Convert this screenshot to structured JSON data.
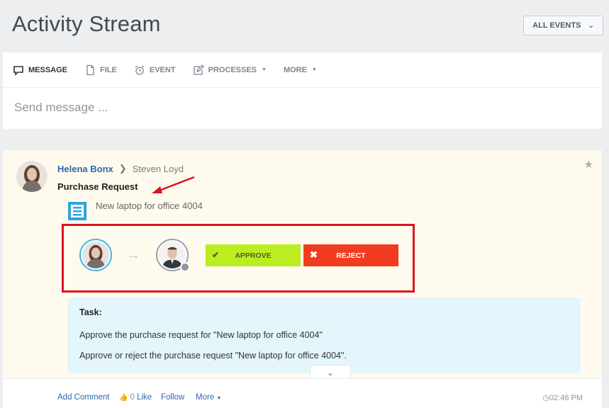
{
  "header": {
    "title": "Activity Stream",
    "filter_label": "ALL EVENTS"
  },
  "composer": {
    "tabs": [
      {
        "label": "MESSAGE",
        "icon": "speech-bubble-icon"
      },
      {
        "label": "FILE",
        "icon": "file-icon"
      },
      {
        "label": "EVENT",
        "icon": "alarm-clock-icon"
      },
      {
        "label": "PROCESSES",
        "icon": "edit-icon"
      },
      {
        "label": "MORE"
      }
    ],
    "placeholder": "Send message ..."
  },
  "post": {
    "author": "Helena Bonx",
    "recipient": "Steven Loyd",
    "title": "Purchase Request",
    "document_title": "New laptop for office 4004",
    "approve_label": "APPROVE",
    "reject_label": "REJECT",
    "task": {
      "heading": "Task:",
      "line1": "Approve the purchase request for \"New laptop for office 4004\"",
      "line2": "Approve or reject the purchase request \"New laptop for office 4004\"."
    },
    "footer": {
      "add_comment": "Add Comment",
      "like_count": "0",
      "like_label": "Like",
      "follow": "Follow",
      "more": "More",
      "time": "02:46 PM"
    }
  },
  "colors": {
    "accent_blue": "#2e66b0",
    "approve": "#bbed21",
    "reject": "#f23c1f",
    "highlight_border": "#d9141e",
    "post_bg": "#fefbee",
    "task_bg": "#e4f6fc"
  }
}
